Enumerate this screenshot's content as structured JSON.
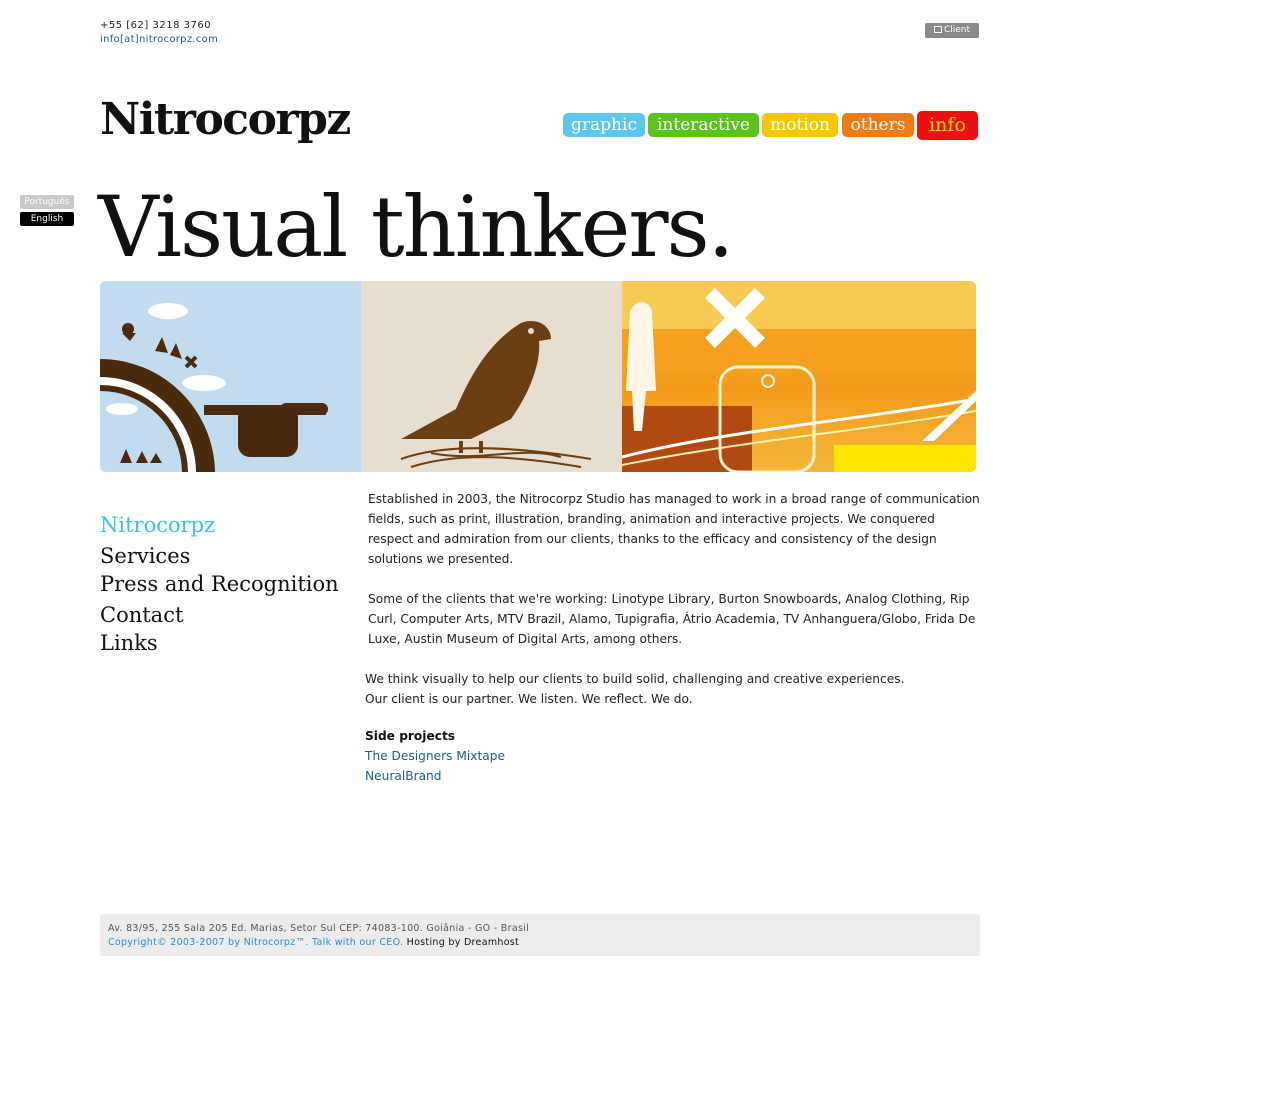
{
  "contact": {
    "phone": "+55 [62] 3218 3760",
    "email": "info[at]nitrocorpz.com"
  },
  "client_button": {
    "label": "Client",
    "icon": "lock-icon"
  },
  "logo": {
    "text": "Nitrocorpz"
  },
  "nav": {
    "items": [
      {
        "label": "graphic",
        "color": "#5cc8f0"
      },
      {
        "label": "interactive",
        "color": "#58c41a"
      },
      {
        "label": "motion",
        "color": "#f7c800"
      },
      {
        "label": "others",
        "color": "#f47a12"
      },
      {
        "label": "info",
        "color": "#ee1111",
        "text_color": "#ffd600"
      }
    ]
  },
  "languages": {
    "portuguese": "Português",
    "english": "English",
    "selected": "English"
  },
  "headline": "Visual thinkers.",
  "sidebar": {
    "items": [
      {
        "label": "Nitrocorpz",
        "active": true
      },
      {
        "label": "Services"
      },
      {
        "label": "Press and Recognition"
      },
      {
        "label": "Contact"
      },
      {
        "label": "Links"
      }
    ]
  },
  "content": {
    "p1": "Established in 2003, the Nitrocorpz Studio has managed to work in a broad range of communication fields, such as print, illustration, branding, animation and interactive projects. We conquered respect and admiration from our clients, thanks to the efficacy and consistency of the design solutions we presented.",
    "p2": "Some of the clients that we're working: Linotype Library, Burton Snowboards, Analog Clothing, Rip Curl, Computer Arts, MTV Brazil, Alamo, Tupigrafia, Átrio Academia, TV Anhanguera/Globo, Frida De Luxe, Austin Museum of Digital Arts, among others.",
    "p3_line1": "We think visually to help our clients to build solid, challenging and creative experiences.",
    "p3_line2": "Our client is our partner. We listen. We reflect. We do.",
    "side_projects_title": "Side projects",
    "side_projects": [
      "The Designers Mixtape",
      "NeuralBrand"
    ]
  },
  "footer": {
    "address": "Av. 83/95, 255 Sala 205 Ed. Marias, Setor Sul CEP: 74083-100. Goiânia - GO - Brasil",
    "copyright": "Copyright© 2003-2007 by Nitrocorpz™.",
    "ceo_link": "Talk with our CEO.",
    "hosting": "Hosting by Dreamhost"
  },
  "banner": {
    "panels": [
      "pointing-hand-illustration",
      "crow-on-nest-illustration",
      "motorola-phone-collage"
    ],
    "colors": [
      "#c3dbef",
      "#e6dfcf",
      "#f5a623"
    ]
  }
}
